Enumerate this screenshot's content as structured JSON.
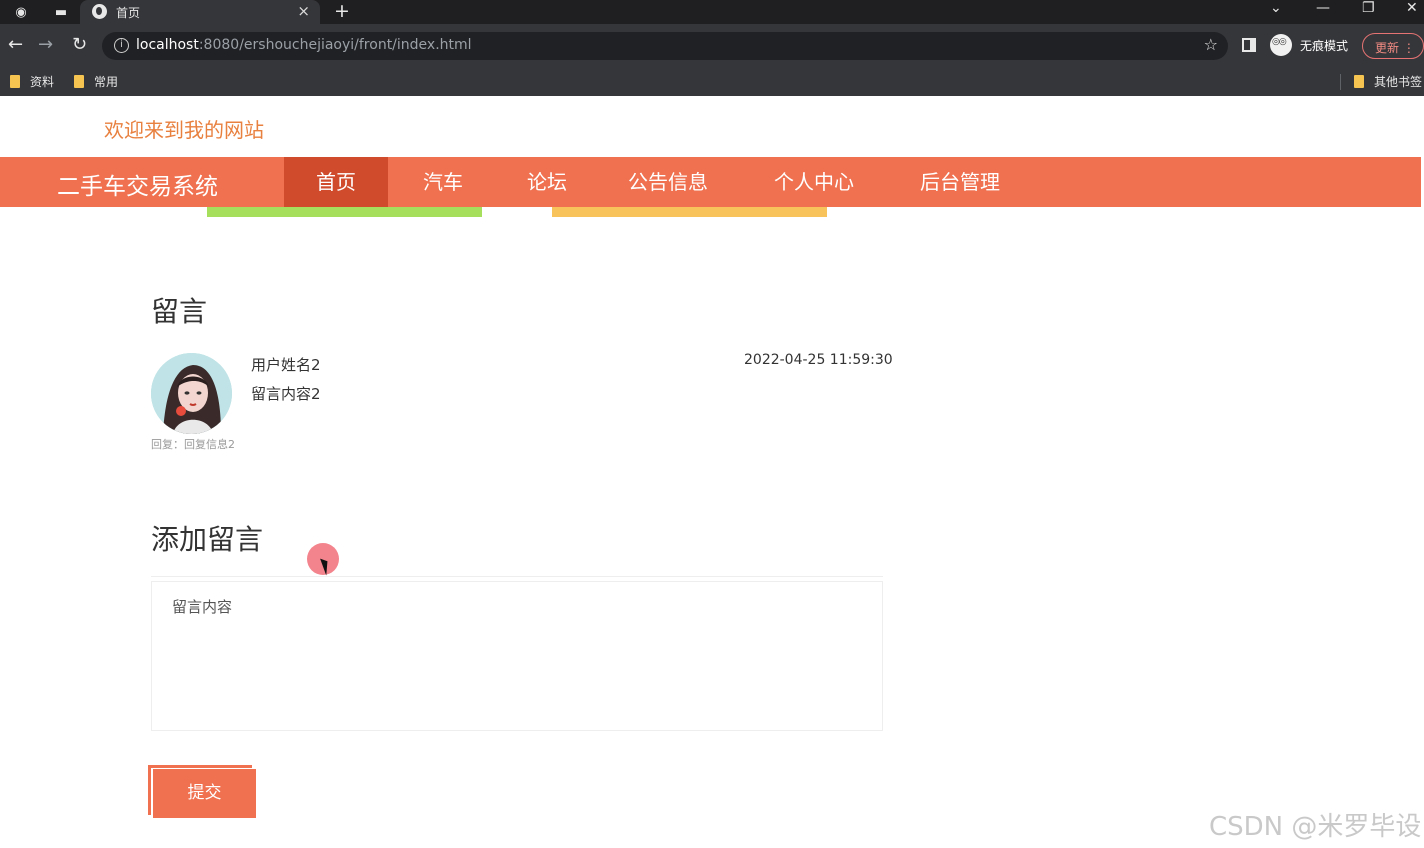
{
  "browser": {
    "tab_title": "首页",
    "new_tab": "+",
    "url_host": "localhost",
    "url_rest": ":8080/ershouchejiaoyi/front/index.html",
    "incognito_label": "无痕模式",
    "update_label": "更新",
    "bookmarks": [
      "资料",
      "常用"
    ],
    "other_bookmarks": "其他书签"
  },
  "header": {
    "welcome": "欢迎来到我的网站",
    "site_title": "二手车交易系统",
    "nav": [
      "首页",
      "汽车",
      "论坛",
      "公告信息",
      "个人中心",
      "后台管理"
    ],
    "active_index": 0
  },
  "messages": {
    "title": "留言",
    "items": [
      {
        "user": "用户姓名2",
        "content": "留言内容2",
        "time": "2022-04-25 11:59:30",
        "reply": "回复：回复信息2"
      }
    ]
  },
  "form": {
    "title": "添加留言",
    "placeholder": "留言内容",
    "submit_label": "提交"
  },
  "watermark": "CSDN @米罗毕设",
  "colors": {
    "nav_bg": "#ef7150",
    "nav_active": "#cf4b2c",
    "welcome": "#e8803f",
    "strip_green": "#a6df5b",
    "strip_yellow": "#f7c35a"
  }
}
